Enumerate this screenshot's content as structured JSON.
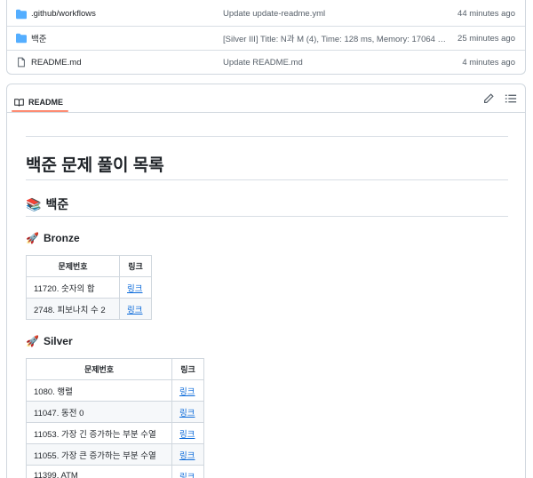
{
  "files": [
    {
      "name": ".github/workflows",
      "type": "folder",
      "message": "Update update-readme.yml",
      "time": "44 minutes ago"
    },
    {
      "name": "백준",
      "type": "folder",
      "message": "[Silver III] Title: N과 M (4), Time: 128 ms, Memory: 17064 …",
      "time": "25 minutes ago"
    },
    {
      "name": "README.md",
      "type": "file",
      "message": "Update README.md",
      "time": "4 minutes ago"
    }
  ],
  "readme": {
    "tab_label": "README",
    "title": "백준 문제 풀이 목록",
    "section": {
      "emoji": "📚",
      "label": "백준"
    },
    "bronze": {
      "emoji": "🚀",
      "label": "Bronze",
      "headers": [
        "문제번호",
        "링크"
      ],
      "rows": [
        {
          "problem": "11720. 숫자의 합",
          "link": "링크"
        },
        {
          "problem": "2748. 피보나치 수 2",
          "link": "링크"
        }
      ]
    },
    "silver": {
      "emoji": "🚀",
      "label": "Silver",
      "headers": [
        "문제번호",
        "링크"
      ],
      "rows": [
        {
          "problem": "1080. 행렬",
          "link": "링크"
        },
        {
          "problem": "11047. 동전 0",
          "link": "링크"
        },
        {
          "problem": "11053. 가장 긴 증가하는 부분 수열",
          "link": "링크"
        },
        {
          "problem": "11055. 가장 큰 증가하는 부분 수열",
          "link": "링크"
        },
        {
          "problem": "11399. ATM",
          "link": "링크"
        }
      ]
    }
  },
  "colors": {
    "folder": "#54aeff",
    "link": "#0969da",
    "tab_underline": "#fd8c73"
  }
}
